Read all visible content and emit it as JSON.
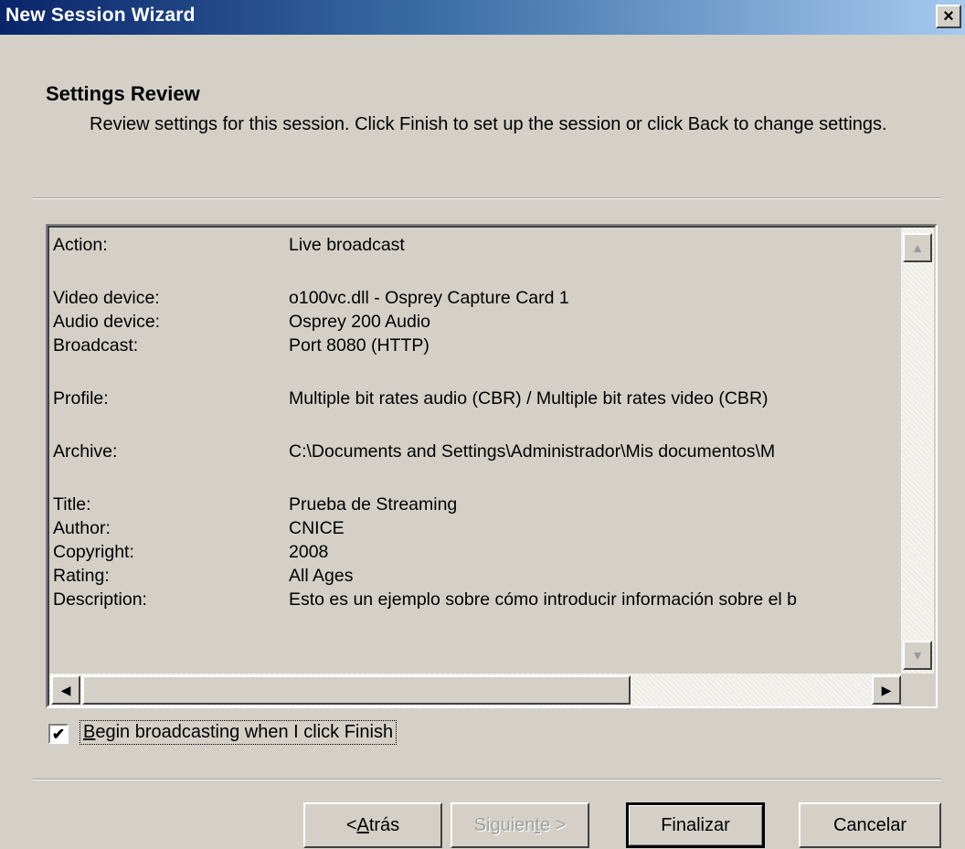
{
  "window": {
    "title": "New Session Wizard",
    "close_label": "×"
  },
  "header": {
    "title": "Settings Review",
    "subtitle": "Review settings for this session. Click Finish to set up the session or click Back to change settings."
  },
  "settings": [
    {
      "label": "Action:",
      "value": "Live broadcast"
    },
    {
      "label": "Video device:",
      "value": "o100vc.dll - Osprey Capture Card 1"
    },
    {
      "label": "Audio device:",
      "value": "Osprey 200 Audio"
    },
    {
      "label": "Broadcast:",
      "value": "Port 8080 (HTTP)"
    },
    {
      "label": "Profile:",
      "value": "Multiple bit rates audio (CBR) / Multiple bit rates video (CBR)"
    },
    {
      "label": "Archive:",
      "value": "C:\\Documents and Settings\\Administrador\\Mis documentos\\M"
    },
    {
      "label": "Title:",
      "value": "Prueba de Streaming"
    },
    {
      "label": "Author:",
      "value": "CNICE"
    },
    {
      "label": "Copyright:",
      "value": "2008"
    },
    {
      "label": "Rating:",
      "value": "All Ages"
    },
    {
      "label": "Description:",
      "value": "Esto es un ejemplo sobre cómo introducir información sobre el b"
    }
  ],
  "scroll": {
    "up_icon": "▲",
    "down_icon": "▼",
    "left_icon": "◀",
    "right_icon": "▶"
  },
  "checkbox": {
    "checked": true,
    "mark": "✔",
    "label_prefix": "",
    "label_mnemonic": "B",
    "label_rest": "egin broadcasting when I click Finish"
  },
  "buttons": {
    "back_prefix": "< ",
    "back_mnemonic": "A",
    "back_rest": "trás",
    "next_prefix": "Siguien",
    "next_mnemonic": "t",
    "next_rest": "e >",
    "finish": "Finalizar",
    "cancel": "Cancelar"
  }
}
